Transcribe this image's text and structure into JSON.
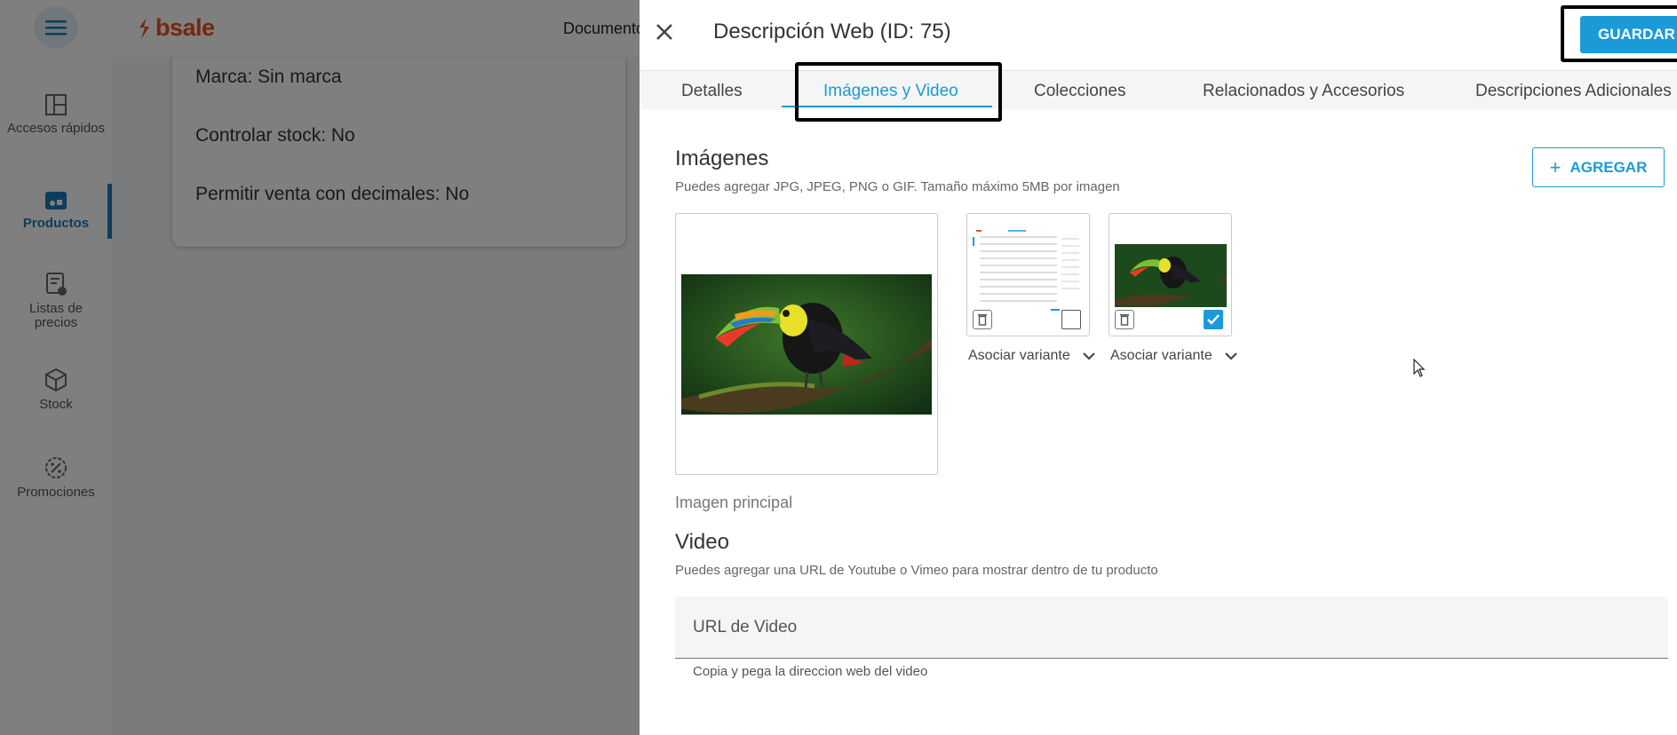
{
  "app": {
    "brand": "bsale",
    "top_nav_item": "Documento",
    "sidebar": {
      "items": [
        {
          "label": "Accesos rápidos",
          "icon": "grid-icon"
        },
        {
          "label": "Productos",
          "icon": "products-icon"
        },
        {
          "label": "Listas de precios",
          "icon": "price-list-icon"
        },
        {
          "label": "Stock",
          "icon": "cube-icon"
        },
        {
          "label": "Promociones",
          "icon": "discount-badge-icon"
        }
      ],
      "active_index": 1
    },
    "product_info": [
      "Marca: Sin marca",
      "Controlar stock: No",
      "Permitir venta con decimales: No"
    ]
  },
  "panel": {
    "title": "Descripción Web (ID: 75)",
    "save_label": "GUARDAR",
    "tabs": [
      {
        "label": "Detalles"
      },
      {
        "label": "Imágenes y Video",
        "active": true
      },
      {
        "label": "Colecciones"
      },
      {
        "label": "Relacionados y Accesorios"
      },
      {
        "label": "Descripciones Adicionales"
      }
    ],
    "images": {
      "title": "Imágenes",
      "subtitle": "Puedes agregar JPG, JPEG, PNG o GIF. Tamaño máximo 5MB por imagen",
      "add_label": "AGREGAR",
      "main_caption": "Imagen principal",
      "thumbnails": [
        {
          "content": "screenshot-table-image",
          "checked": false,
          "variant_label": "Asociar variante"
        },
        {
          "content": "toucan-image",
          "checked": true,
          "variant_label": "Asociar variante"
        }
      ]
    },
    "video": {
      "title": "Video",
      "subtitle": "Puedes agregar una URL de Youtube o Vimeo para mostrar dentro de tu producto",
      "field_label": "URL de Video",
      "field_value": "",
      "helper": "Copia y pega la direccion web del video"
    }
  },
  "colors": {
    "accent": "#1a9bd7",
    "brand": "#e8501e",
    "overlay": "rgba(0,0,0,0.5)"
  }
}
